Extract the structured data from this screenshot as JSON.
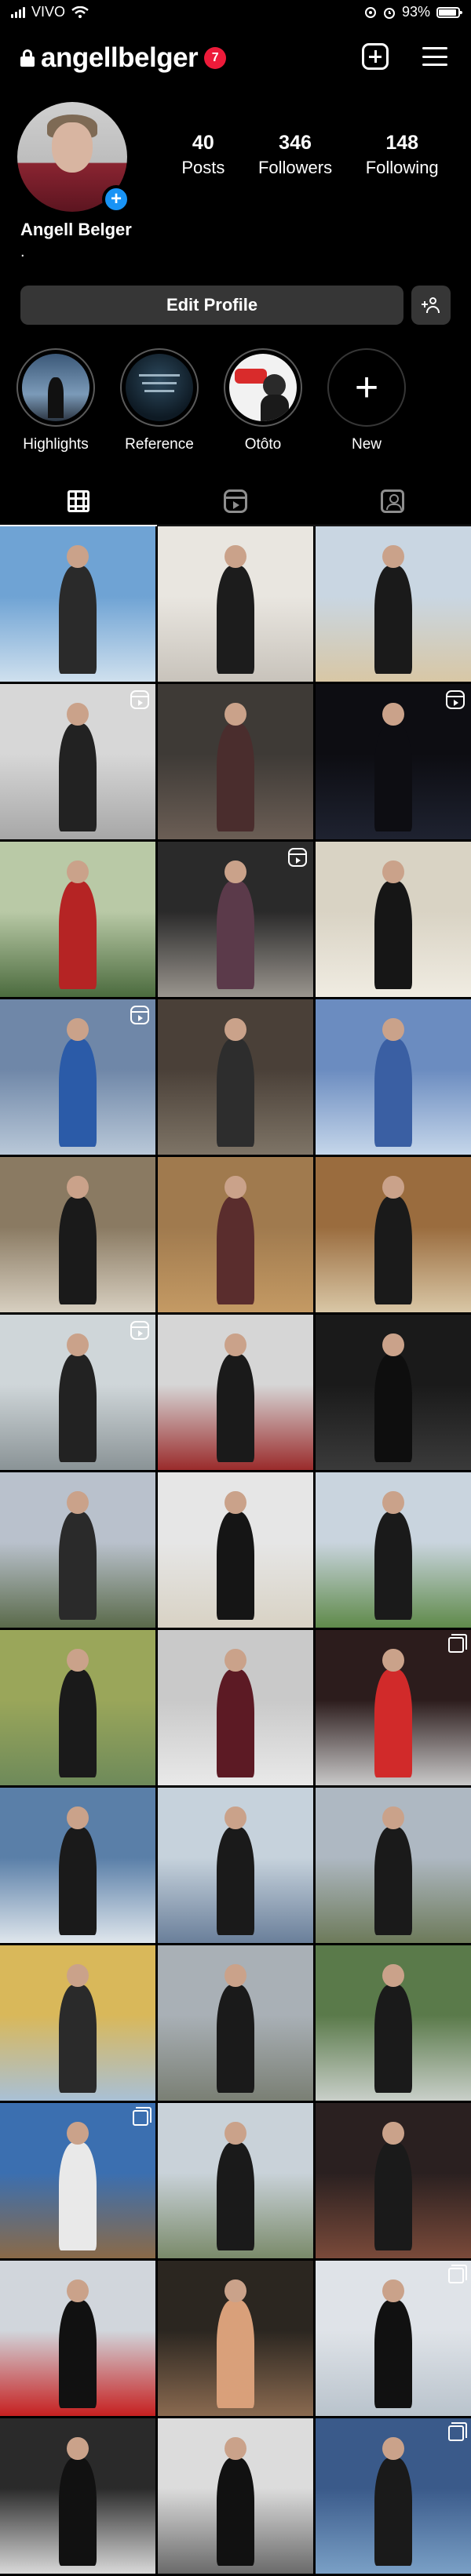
{
  "status_bar": {
    "carrier": "VIVO",
    "battery": "93%"
  },
  "header": {
    "username": "angellbelger",
    "notification_count": "7"
  },
  "profile": {
    "display_name": "Angell Belger",
    "bio": ".",
    "stats": [
      {
        "value": "40",
        "label": "Posts"
      },
      {
        "value": "346",
        "label": "Followers"
      },
      {
        "value": "148",
        "label": "Following"
      }
    ],
    "edit_label": "Edit Profile"
  },
  "highlights": [
    {
      "label": "Highlights"
    },
    {
      "label": "Reference"
    },
    {
      "label": "Otôto"
    },
    {
      "label": "New"
    }
  ],
  "colors": {
    "accent_blue": "#1993f5",
    "badge_red": "#ed1b3a",
    "button_gray": "#363636"
  },
  "posts": [
    {
      "type": "photo"
    },
    {
      "type": "photo"
    },
    {
      "type": "photo"
    },
    {
      "type": "reel"
    },
    {
      "type": "photo"
    },
    {
      "type": "reel"
    },
    {
      "type": "photo"
    },
    {
      "type": "reel"
    },
    {
      "type": "photo"
    },
    {
      "type": "reel"
    },
    {
      "type": "photo"
    },
    {
      "type": "photo"
    },
    {
      "type": "photo"
    },
    {
      "type": "photo"
    },
    {
      "type": "photo"
    },
    {
      "type": "reel"
    },
    {
      "type": "photo"
    },
    {
      "type": "photo"
    },
    {
      "type": "photo"
    },
    {
      "type": "photo"
    },
    {
      "type": "photo"
    },
    {
      "type": "photo"
    },
    {
      "type": "photo"
    },
    {
      "type": "carousel"
    },
    {
      "type": "photo"
    },
    {
      "type": "photo"
    },
    {
      "type": "photo"
    },
    {
      "type": "photo"
    },
    {
      "type": "photo"
    },
    {
      "type": "photo"
    },
    {
      "type": "carousel"
    },
    {
      "type": "photo"
    },
    {
      "type": "photo"
    },
    {
      "type": "photo"
    },
    {
      "type": "photo"
    },
    {
      "type": "carousel"
    },
    {
      "type": "photo"
    },
    {
      "type": "photo"
    },
    {
      "type": "carousel"
    }
  ]
}
